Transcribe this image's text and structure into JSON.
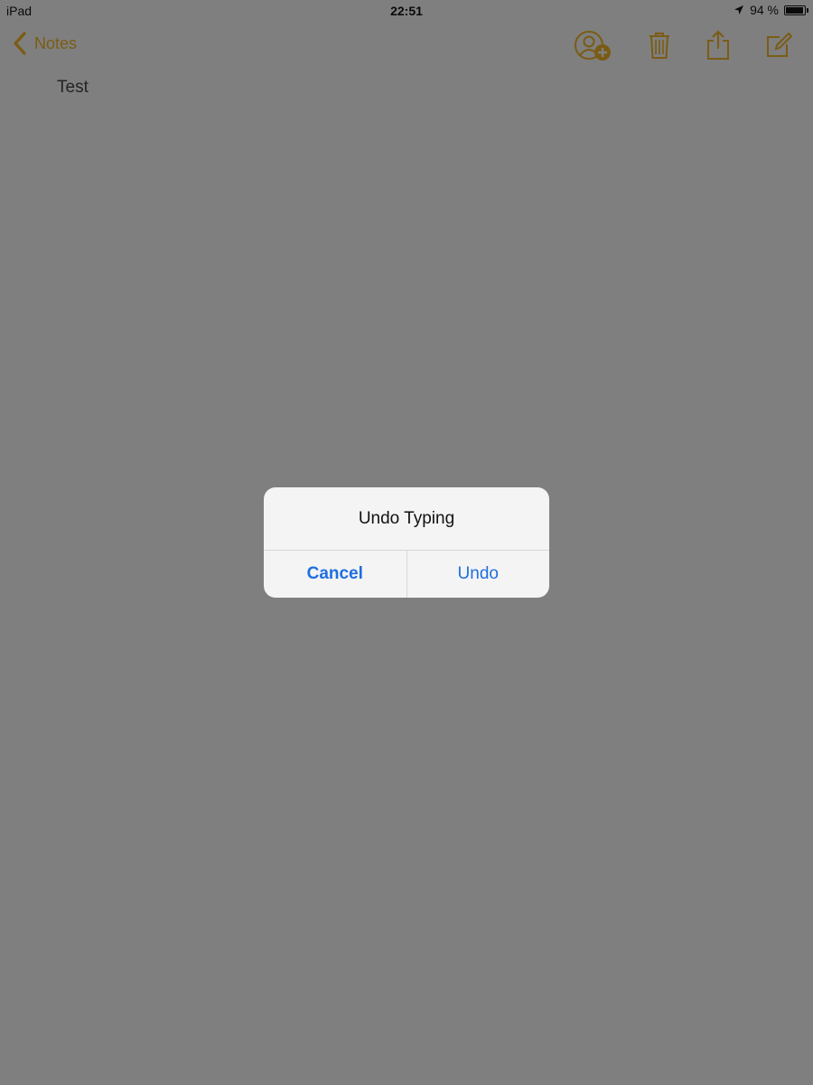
{
  "status_bar": {
    "device": "iPad",
    "time": "22:51",
    "battery_text": "94 %",
    "battery_level": 0.94,
    "location_icon": "location-arrow-icon"
  },
  "nav": {
    "back_label": "Notes",
    "back_icon": "chevron-left-icon",
    "tools": [
      "add-person-icon",
      "trash-icon",
      "share-icon",
      "compose-icon"
    ]
  },
  "note": {
    "text": "Test"
  },
  "alert": {
    "title": "Undo Typing",
    "cancel_label": "Cancel",
    "undo_label": "Undo"
  },
  "colors": {
    "accent": "#7a5c14",
    "alert_button": "#1f6fe0",
    "dim_background": "#7f7f7f"
  }
}
